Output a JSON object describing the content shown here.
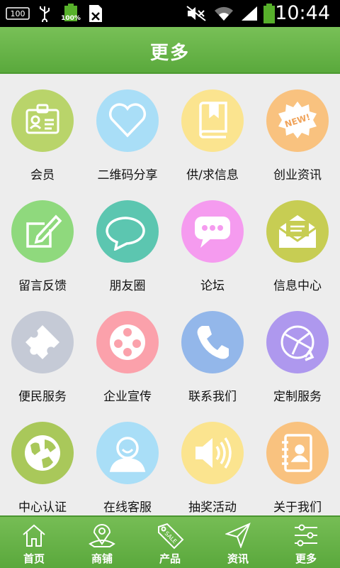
{
  "status_bar": {
    "time": "10:44",
    "battery_label": "100%",
    "sim_badge": "100",
    "icons": [
      "sim-card-icon",
      "usb-icon",
      "battery-full-icon",
      "sd-card-icon",
      "mute-icon",
      "wifi-icon",
      "signal-icon",
      "battery-icon"
    ]
  },
  "header": {
    "title": "更多"
  },
  "grid": {
    "items": [
      {
        "label": "会员",
        "icon": "member-card-icon",
        "color": "#b9d46a"
      },
      {
        "label": "二维码分享",
        "icon": "heart-icon",
        "color": "#a9def7"
      },
      {
        "label": "供/求信息",
        "icon": "book-icon",
        "color": "#fbe48f"
      },
      {
        "label": "创业资讯",
        "icon": "new-badge-icon",
        "color": "#f9c27f"
      },
      {
        "label": "留言反馈",
        "icon": "edit-icon",
        "color": "#8fd97d"
      },
      {
        "label": "朋友圈",
        "icon": "speech-bubble-icon",
        "color": "#5cc6b0"
      },
      {
        "label": "论坛",
        "icon": "chat-dots-icon",
        "color": "#f59bef"
      },
      {
        "label": "信息中心",
        "icon": "mail-icon",
        "color": "#c7cd53"
      },
      {
        "label": "便民服务",
        "icon": "puzzle-icon",
        "color": "#c5cad6"
      },
      {
        "label": "企业宣传",
        "icon": "film-reel-icon",
        "color": "#fba1ab"
      },
      {
        "label": "联系我们",
        "icon": "phone-icon",
        "color": "#93b7ea"
      },
      {
        "label": "定制服务",
        "icon": "globe-network-icon",
        "color": "#ae98ee"
      },
      {
        "label": "中心认证",
        "icon": "globe-icon",
        "color": "#a9c85a"
      },
      {
        "label": "在线客服",
        "icon": "user-icon",
        "color": "#a9def7"
      },
      {
        "label": "抽奖活动",
        "icon": "speaker-icon",
        "color": "#fbe48f"
      },
      {
        "label": "关于我们",
        "icon": "contacts-book-icon",
        "color": "#f9c27f"
      }
    ]
  },
  "tabbar": {
    "tabs": [
      {
        "label": "首页",
        "icon": "home-icon"
      },
      {
        "label": "商铺",
        "icon": "map-icon"
      },
      {
        "label": "产品",
        "icon": "sale-tag-icon",
        "tag_text": "SALE"
      },
      {
        "label": "资讯",
        "icon": "send-icon"
      },
      {
        "label": "更多",
        "icon": "sliders-icon"
      }
    ]
  },
  "colors": {
    "header_green": "#66b247",
    "background": "#ededed"
  },
  "badges": {
    "new_text": "NEW!"
  }
}
